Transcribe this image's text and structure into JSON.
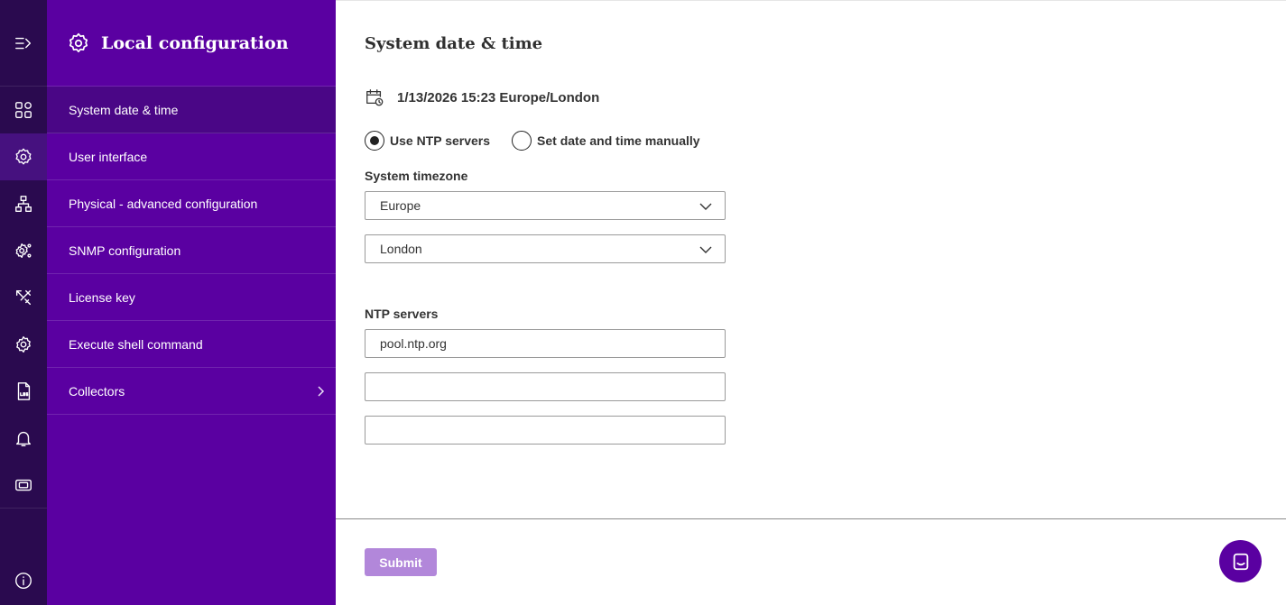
{
  "colors": {
    "rail_bg": "#2a0a4f",
    "panel_bg": "#5a00a1",
    "active_item_bg": "#4a0686",
    "submit_bg": "#b287da",
    "chat_bg": "#5a00a1"
  },
  "rail": {
    "items": [
      {
        "icon": "expand-menu-icon"
      },
      {
        "icon": "dashboard-grid-icon"
      },
      {
        "icon": "settings-gear-icon",
        "active": true
      },
      {
        "icon": "network-topology-icon"
      },
      {
        "icon": "gear-settings-icon"
      },
      {
        "icon": "tools-icon"
      },
      {
        "icon": "cog-icon"
      },
      {
        "icon": "log-file-icon"
      },
      {
        "icon": "bell-icon"
      },
      {
        "icon": "ticket-icon"
      },
      {
        "icon": "info-icon"
      }
    ]
  },
  "subnav": {
    "title": "Local configuration",
    "items": [
      {
        "label": "System date & time",
        "active": true
      },
      {
        "label": "User interface"
      },
      {
        "label": "Physical - advanced configuration"
      },
      {
        "label": "SNMP configuration"
      },
      {
        "label": "License key"
      },
      {
        "label": "Execute shell command"
      },
      {
        "label": "Collectors",
        "has_children": true
      }
    ]
  },
  "main": {
    "title": "System date & time",
    "current_datetime": "1/13/2026 15:23 Europe/London",
    "radio_ntp": {
      "label": "Use NTP servers",
      "selected": true
    },
    "radio_manual": {
      "label": "Set date and time manually",
      "selected": false
    },
    "timezone_label": "System timezone",
    "timezone_region": "Europe",
    "timezone_city": "London",
    "ntp_label": "NTP servers",
    "ntp_servers": [
      "pool.ntp.org",
      "",
      ""
    ],
    "submit_label": "Submit"
  }
}
